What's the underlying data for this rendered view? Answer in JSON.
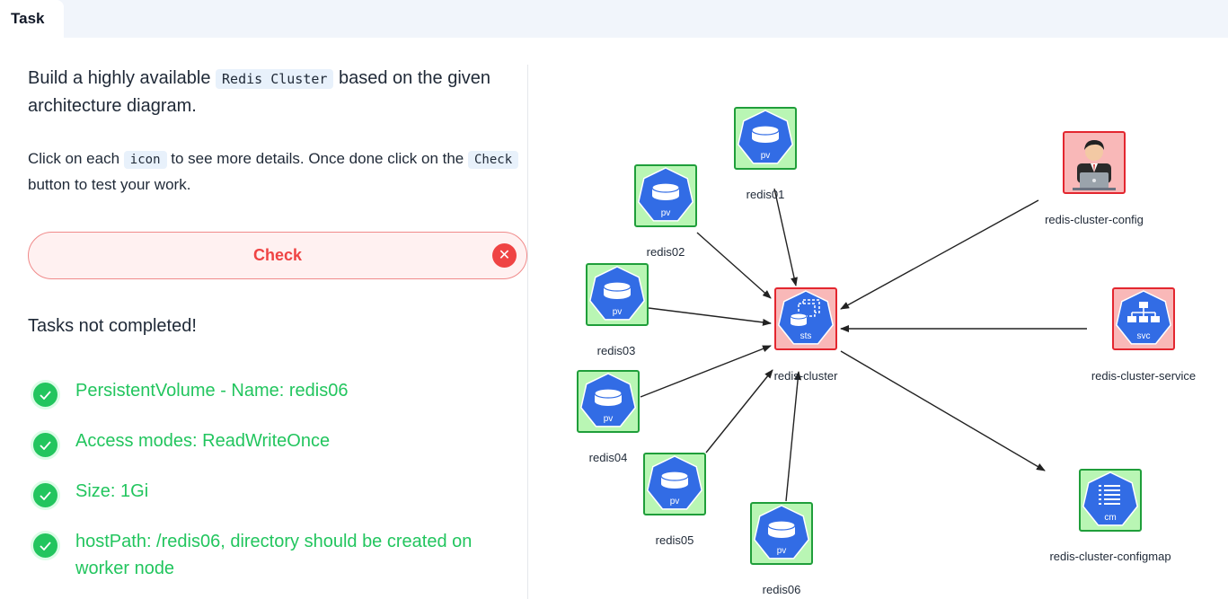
{
  "tabs": [
    {
      "label": "Task"
    }
  ],
  "instructions": {
    "line1_pre": "Build a highly available",
    "line1_code": "Redis Cluster",
    "line1_post": "based on the given architecture diagram.",
    "line2_pre": "Click on each",
    "line2_code1": "icon",
    "line2_mid": "to see more details. Once done click on the",
    "line2_code2": "Check",
    "line2_post": "button to test your work."
  },
  "check_button": {
    "label": "Check",
    "close": "✕"
  },
  "status": "Tasks not completed!",
  "tasks": [
    {
      "text": "PersistentVolume - Name: redis06",
      "done": true
    },
    {
      "text": "Access modes: ReadWriteOnce",
      "done": true
    },
    {
      "text": "Size: 1Gi",
      "done": true
    },
    {
      "text": "hostPath: /redis06, directory should be created on worker node",
      "done": true
    }
  ],
  "diagram": {
    "nodes": [
      {
        "id": "redis01",
        "label": "redis01",
        "badge": "pv",
        "kind": "pv",
        "status": "ok"
      },
      {
        "id": "redis02",
        "label": "redis02",
        "badge": "pv",
        "kind": "pv",
        "status": "ok"
      },
      {
        "id": "redis03",
        "label": "redis03",
        "badge": "pv",
        "kind": "pv",
        "status": "ok"
      },
      {
        "id": "redis04",
        "label": "redis04",
        "badge": "pv",
        "kind": "pv",
        "status": "ok"
      },
      {
        "id": "redis05",
        "label": "redis05",
        "badge": "pv",
        "kind": "pv",
        "status": "ok"
      },
      {
        "id": "redis06",
        "label": "redis06",
        "badge": "pv",
        "kind": "pv",
        "status": "ok"
      },
      {
        "id": "redis-cluster",
        "label": "redis-cluster",
        "badge": "sts",
        "kind": "sts",
        "status": "bad"
      },
      {
        "id": "redis-cluster-config",
        "label": "redis-cluster-config",
        "badge": "",
        "kind": "user",
        "status": "bad"
      },
      {
        "id": "redis-cluster-service",
        "label": "redis-cluster-service",
        "badge": "svc",
        "kind": "svc",
        "status": "bad"
      },
      {
        "id": "redis-cluster-configmap",
        "label": "redis-cluster-configmap",
        "badge": "cm",
        "kind": "cm",
        "status": "ok"
      }
    ],
    "colors": {
      "ok_fill": "#b9f6b4",
      "ok_border": "#1f9e3a",
      "bad_fill": "#f9b8b8",
      "bad_border": "#e3262f",
      "k8s_blue": "#326ce5",
      "done_green": "#22c55e"
    }
  }
}
